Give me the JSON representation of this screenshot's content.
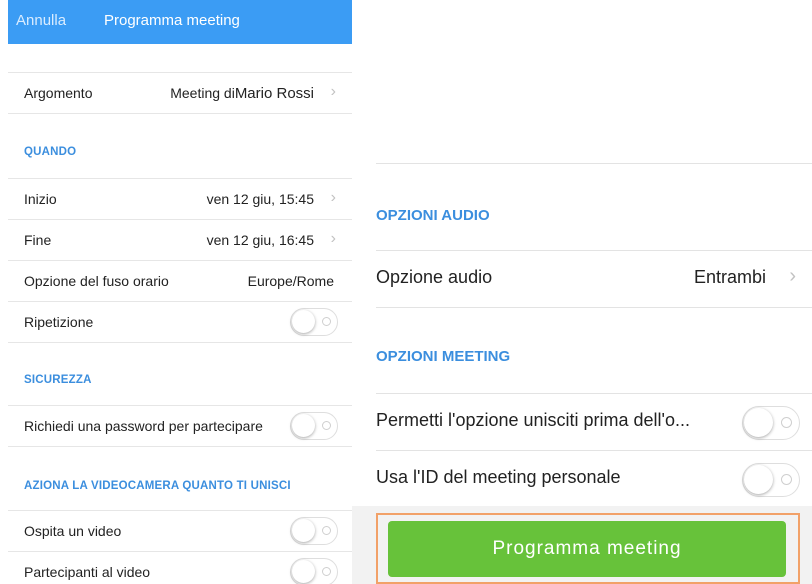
{
  "left_panel": {
    "header": {
      "cancel_label": "Annulla",
      "title": "Programma meeting"
    },
    "topic": {
      "label": "Argomento",
      "value_prefix": "Meeting di",
      "value_name": "Mario Rossi"
    },
    "when": {
      "section_title": "QUANDO",
      "start": {
        "label": "Inizio",
        "value": "ven 12 giu, 15:45"
      },
      "end": {
        "label": "Fine",
        "value": "ven 12 giu, 16:45"
      },
      "timezone": {
        "label": "Opzione del fuso orario",
        "value": "Europe/Rome"
      },
      "repeat": {
        "label": "Ripetizione",
        "enabled": false
      }
    },
    "security": {
      "section_title": "SICUREZZA",
      "password": {
        "label": "Richiedi una password per partecipare",
        "enabled": false
      }
    },
    "video": {
      "section_title": "AZIONA LA VIDEOCAMERA QUANTO TI UNISCI",
      "host": {
        "label": "Ospita un video",
        "enabled": false
      },
      "participants": {
        "label": "Partecipanti al video",
        "enabled": false
      }
    }
  },
  "right_panel": {
    "audio": {
      "section_title": "OPZIONI AUDIO",
      "audio_option": {
        "label": "Opzione audio",
        "value": "Entrambi"
      }
    },
    "meeting": {
      "section_title": "OPZIONI MEETING",
      "join_before_host": {
        "label": "Permetti l'opzione unisciti prima dell'o...",
        "enabled": false
      },
      "personal_id": {
        "label": "Usa l'ID del meeting personale",
        "enabled": false
      }
    },
    "schedule_button": {
      "label": "Programma meeting"
    }
  },
  "colors": {
    "header_blue": "#3b9cf4",
    "section_blue": "#3b8ede",
    "button_green": "#67c23a",
    "highlight_orange": "#f2a168"
  },
  "icons": {
    "chevron": "chevron-right-icon",
    "toggle_knob": "toggle-knob-icon"
  }
}
